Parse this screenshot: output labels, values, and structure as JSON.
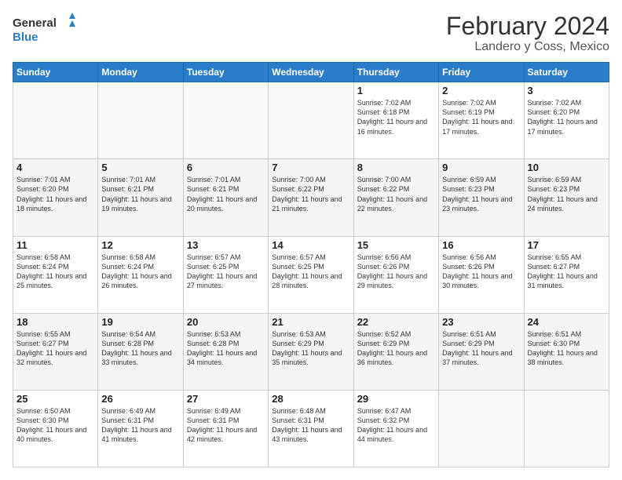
{
  "logo": {
    "line1": "General",
    "line2": "Blue"
  },
  "title": "February 2024",
  "subtitle": "Landero y Coss, Mexico",
  "days_of_week": [
    "Sunday",
    "Monday",
    "Tuesday",
    "Wednesday",
    "Thursday",
    "Friday",
    "Saturday"
  ],
  "weeks": [
    [
      {
        "day": "",
        "info": ""
      },
      {
        "day": "",
        "info": ""
      },
      {
        "day": "",
        "info": ""
      },
      {
        "day": "",
        "info": ""
      },
      {
        "day": "1",
        "info": "Sunrise: 7:02 AM\nSunset: 6:18 PM\nDaylight: 11 hours and 16 minutes."
      },
      {
        "day": "2",
        "info": "Sunrise: 7:02 AM\nSunset: 6:19 PM\nDaylight: 11 hours and 17 minutes."
      },
      {
        "day": "3",
        "info": "Sunrise: 7:02 AM\nSunset: 6:20 PM\nDaylight: 11 hours and 17 minutes."
      }
    ],
    [
      {
        "day": "4",
        "info": "Sunrise: 7:01 AM\nSunset: 6:20 PM\nDaylight: 11 hours and 18 minutes."
      },
      {
        "day": "5",
        "info": "Sunrise: 7:01 AM\nSunset: 6:21 PM\nDaylight: 11 hours and 19 minutes."
      },
      {
        "day": "6",
        "info": "Sunrise: 7:01 AM\nSunset: 6:21 PM\nDaylight: 11 hours and 20 minutes."
      },
      {
        "day": "7",
        "info": "Sunrise: 7:00 AM\nSunset: 6:22 PM\nDaylight: 11 hours and 21 minutes."
      },
      {
        "day": "8",
        "info": "Sunrise: 7:00 AM\nSunset: 6:22 PM\nDaylight: 11 hours and 22 minutes."
      },
      {
        "day": "9",
        "info": "Sunrise: 6:59 AM\nSunset: 6:23 PM\nDaylight: 11 hours and 23 minutes."
      },
      {
        "day": "10",
        "info": "Sunrise: 6:59 AM\nSunset: 6:23 PM\nDaylight: 11 hours and 24 minutes."
      }
    ],
    [
      {
        "day": "11",
        "info": "Sunrise: 6:58 AM\nSunset: 6:24 PM\nDaylight: 11 hours and 25 minutes."
      },
      {
        "day": "12",
        "info": "Sunrise: 6:58 AM\nSunset: 6:24 PM\nDaylight: 11 hours and 26 minutes."
      },
      {
        "day": "13",
        "info": "Sunrise: 6:57 AM\nSunset: 6:25 PM\nDaylight: 11 hours and 27 minutes."
      },
      {
        "day": "14",
        "info": "Sunrise: 6:57 AM\nSunset: 6:25 PM\nDaylight: 11 hours and 28 minutes."
      },
      {
        "day": "15",
        "info": "Sunrise: 6:56 AM\nSunset: 6:26 PM\nDaylight: 11 hours and 29 minutes."
      },
      {
        "day": "16",
        "info": "Sunrise: 6:56 AM\nSunset: 6:26 PM\nDaylight: 11 hours and 30 minutes."
      },
      {
        "day": "17",
        "info": "Sunrise: 6:55 AM\nSunset: 6:27 PM\nDaylight: 11 hours and 31 minutes."
      }
    ],
    [
      {
        "day": "18",
        "info": "Sunrise: 6:55 AM\nSunset: 6:27 PM\nDaylight: 11 hours and 32 minutes."
      },
      {
        "day": "19",
        "info": "Sunrise: 6:54 AM\nSunset: 6:28 PM\nDaylight: 11 hours and 33 minutes."
      },
      {
        "day": "20",
        "info": "Sunrise: 6:53 AM\nSunset: 6:28 PM\nDaylight: 11 hours and 34 minutes."
      },
      {
        "day": "21",
        "info": "Sunrise: 6:53 AM\nSunset: 6:29 PM\nDaylight: 11 hours and 35 minutes."
      },
      {
        "day": "22",
        "info": "Sunrise: 6:52 AM\nSunset: 6:29 PM\nDaylight: 11 hours and 36 minutes."
      },
      {
        "day": "23",
        "info": "Sunrise: 6:51 AM\nSunset: 6:29 PM\nDaylight: 11 hours and 37 minutes."
      },
      {
        "day": "24",
        "info": "Sunrise: 6:51 AM\nSunset: 6:30 PM\nDaylight: 11 hours and 38 minutes."
      }
    ],
    [
      {
        "day": "25",
        "info": "Sunrise: 6:50 AM\nSunset: 6:30 PM\nDaylight: 11 hours and 40 minutes."
      },
      {
        "day": "26",
        "info": "Sunrise: 6:49 AM\nSunset: 6:31 PM\nDaylight: 11 hours and 41 minutes."
      },
      {
        "day": "27",
        "info": "Sunrise: 6:49 AM\nSunset: 6:31 PM\nDaylight: 11 hours and 42 minutes."
      },
      {
        "day": "28",
        "info": "Sunrise: 6:48 AM\nSunset: 6:31 PM\nDaylight: 11 hours and 43 minutes."
      },
      {
        "day": "29",
        "info": "Sunrise: 6:47 AM\nSunset: 6:32 PM\nDaylight: 11 hours and 44 minutes."
      },
      {
        "day": "",
        "info": ""
      },
      {
        "day": "",
        "info": ""
      }
    ]
  ]
}
